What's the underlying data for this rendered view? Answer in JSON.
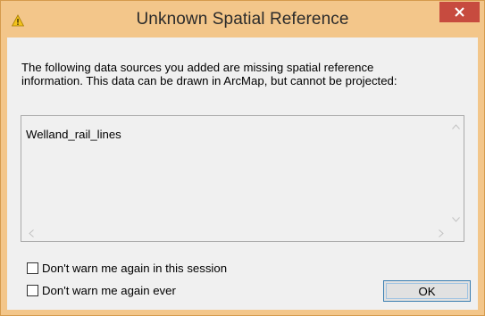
{
  "window": {
    "title": "Unknown Spatial Reference",
    "icon": "warning-icon",
    "accent_color": "#f3c68a",
    "close_color": "#c74b3f"
  },
  "message": {
    "line1": "The following data sources you added are missing spatial reference",
    "line2": "information. This data can be drawn in ArcMap, but cannot be projected:"
  },
  "list": {
    "items": [
      "Welland_rail_lines"
    ]
  },
  "options": {
    "session_label": "Don't warn me again in this session",
    "session_checked": false,
    "ever_label": "Don't warn me again ever",
    "ever_checked": false
  },
  "buttons": {
    "ok_label": "OK"
  }
}
